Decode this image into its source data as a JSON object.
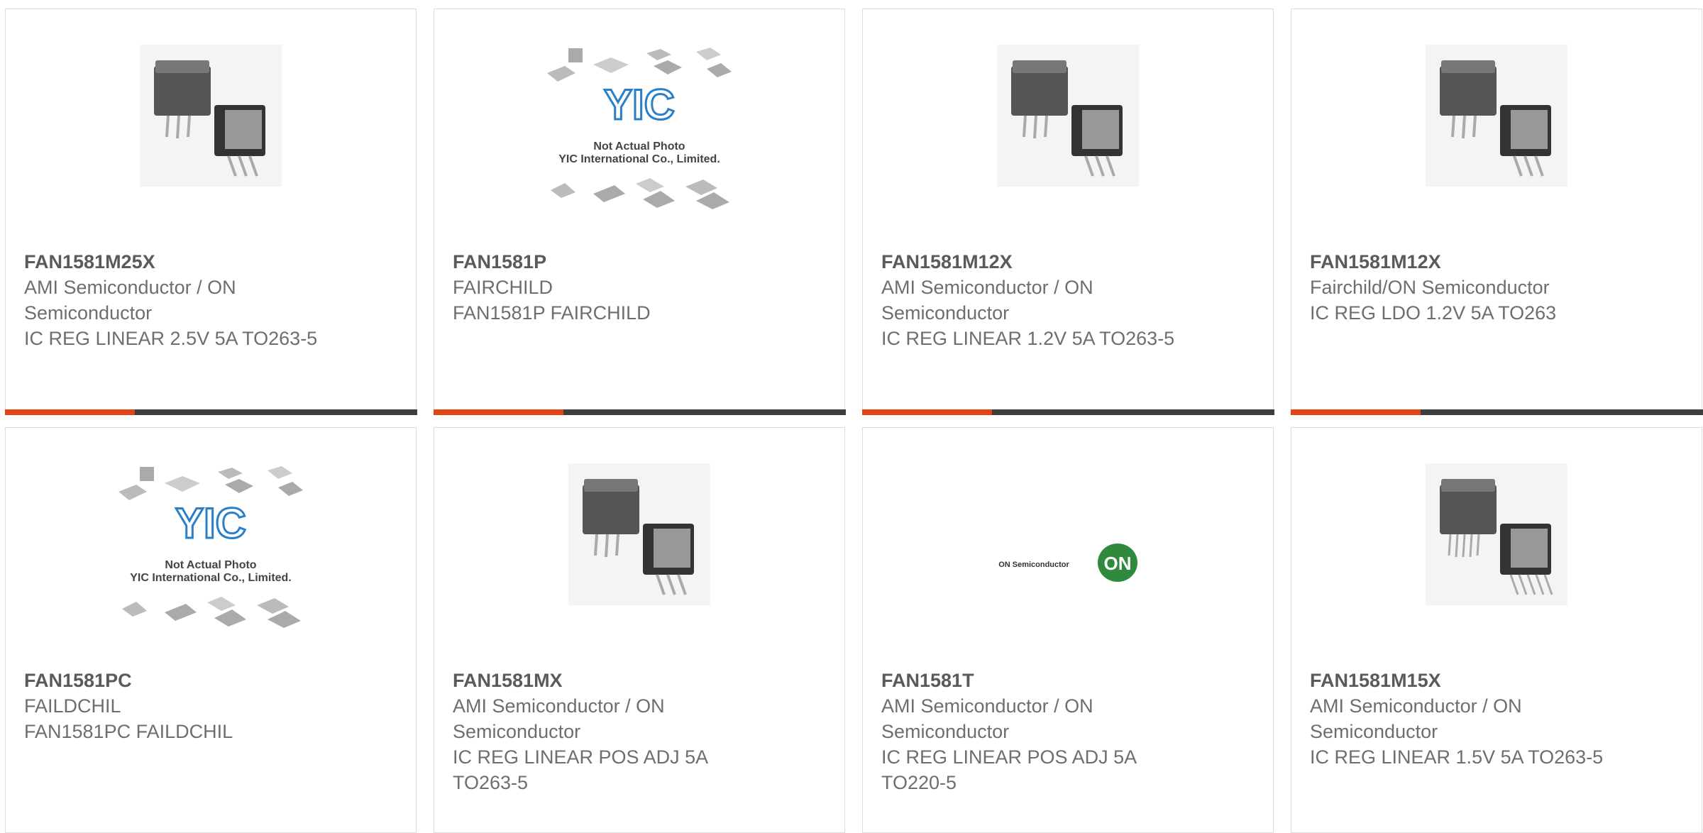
{
  "products": [
    {
      "part": "FAN1581M25X",
      "manufacturer": "AMI Semiconductor / ON Semiconductor",
      "description": "IC REG LINEAR 2.5V 5A TO263-5",
      "image": "to263-package-photo"
    },
    {
      "part": "FAN1581P",
      "manufacturer": "FAIRCHILD",
      "description": "FAN1581P FAIRCHILD",
      "image": "yic-placeholder",
      "placeholder_line1": "Not Actual Photo",
      "placeholder_line2": "YIC International Co., Limited."
    },
    {
      "part": "FAN1581M12X",
      "manufacturer": "AMI Semiconductor / ON Semiconductor",
      "description": "IC REG LINEAR 1.2V 5A TO263-5",
      "image": "to263-package-photo"
    },
    {
      "part": "FAN1581M12X",
      "manufacturer": "Fairchild/ON Semiconductor",
      "description": "IC REG LDO 1.2V 5A TO263",
      "image": "to263-package-photo"
    },
    {
      "part": "FAN1581PC",
      "manufacturer": "FAILDCHIL",
      "description": "FAN1581PC FAILDCHIL",
      "image": "yic-placeholder",
      "placeholder_line1": "Not Actual Photo",
      "placeholder_line2": "YIC International Co., Limited."
    },
    {
      "part": "FAN1581MX",
      "manufacturer": "AMI Semiconductor / ON Semiconductor",
      "description": "IC REG LINEAR POS ADJ 5A TO263-5",
      "image": "to263-package-photo"
    },
    {
      "part": "FAN1581T",
      "manufacturer": "AMI Semiconductor / ON Semiconductor",
      "description": "IC REG LINEAR POS ADJ 5A TO220-5",
      "image": "on-semiconductor-logo",
      "logo_text": "ON Semiconductor",
      "logo_mark": "ON"
    },
    {
      "part": "FAN1581M15X",
      "manufacturer": "AMI Semiconductor / ON Semiconductor",
      "description": "IC REG LINEAR 1.5V 5A TO263-5",
      "image": "to263-package-photo"
    }
  ],
  "colors": {
    "accent": "#e34413",
    "bar": "#3d3d3d",
    "border": "#dcdcdc",
    "text": "#666666"
  }
}
